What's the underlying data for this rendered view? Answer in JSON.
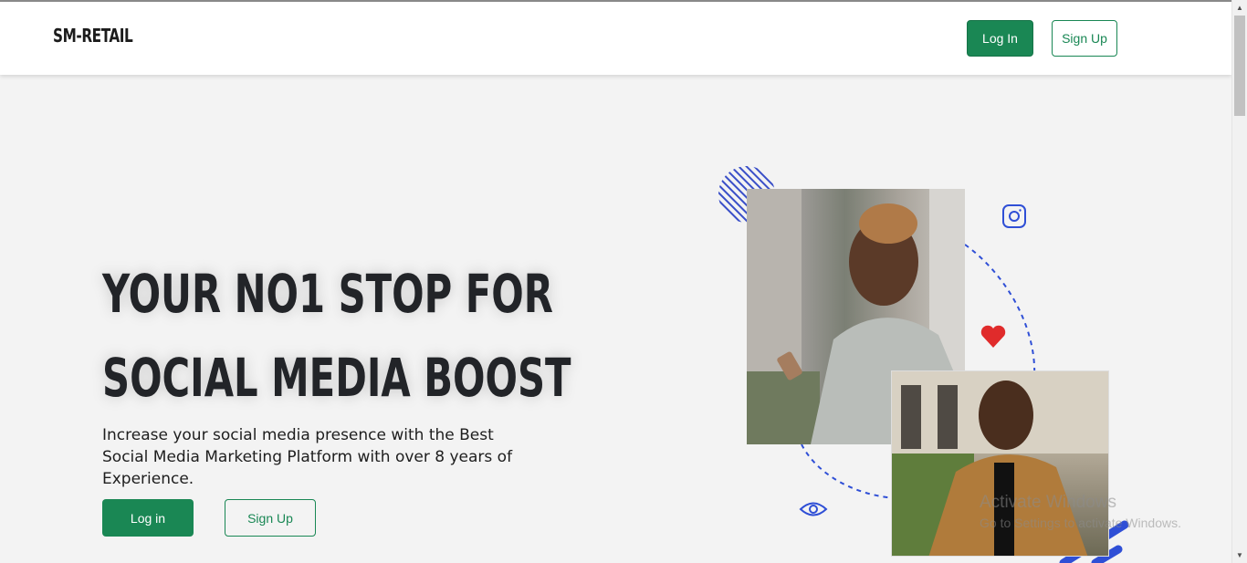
{
  "navbar": {
    "brand": "SM-RETAIL",
    "login_label": "Log In",
    "signup_label": "Sign Up"
  },
  "hero": {
    "title_line1": "YOUR NO1 STOP FOR",
    "title_line2": "SOCIAL MEDIA BOOST",
    "subtitle": "Increase your social media presence with the Best Social Media Marketing Platform with over 8 years of Experience.",
    "login_label": "Log in",
    "signup_label": "Sign Up"
  },
  "decor": {
    "icons": [
      "instagram-icon",
      "heart-icon",
      "eye-icon"
    ],
    "accent_blue": "#2f4fd6",
    "heart_red": "#e02b2b"
  },
  "watermark": {
    "title": "Activate Windows",
    "subtitle": "Go to Settings to activate Windows."
  },
  "colors": {
    "primary_green": "#198754",
    "background": "#f3f3f3",
    "navbar_bg": "#ffffff",
    "heading": "#222428"
  }
}
